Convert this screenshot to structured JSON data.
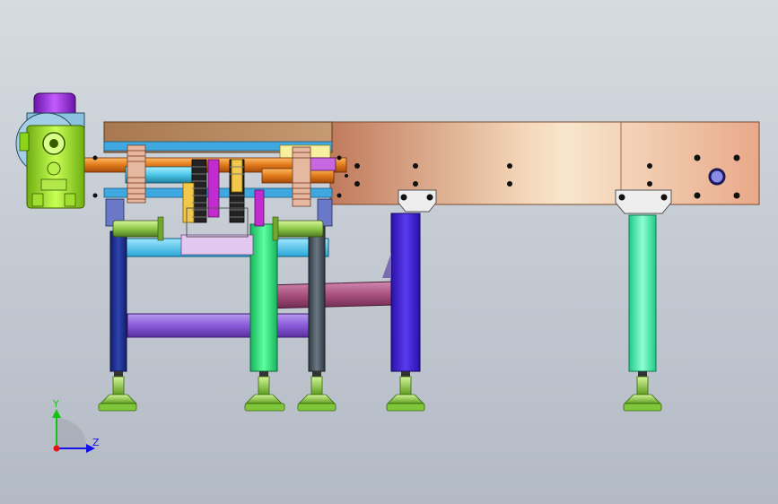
{
  "viewport": {
    "background_top": "#d6dbe1",
    "background_bottom": "#b3bac4"
  },
  "triad": {
    "y_label": "Y",
    "z_label": "Z",
    "y_color": "#11c411",
    "z_color": "#1212e8",
    "x_color": "#e81212"
  },
  "colors": {
    "conveyor_frame": "#c98d6b",
    "motor_body": "#9ee021",
    "motor_cap": "#9a2fd6",
    "leg_navy": "#1f2f8a",
    "leg_green": "#22dd7a",
    "leg_slate": "#4a5560",
    "leg_blue": "#3b1fd0",
    "leg_mint": "#3fe8a8",
    "cross_brace": "#8a5ad8",
    "diagonal_brace": "#a8507e",
    "feet": "#8fd84a",
    "gear": "#e7b8a0"
  }
}
